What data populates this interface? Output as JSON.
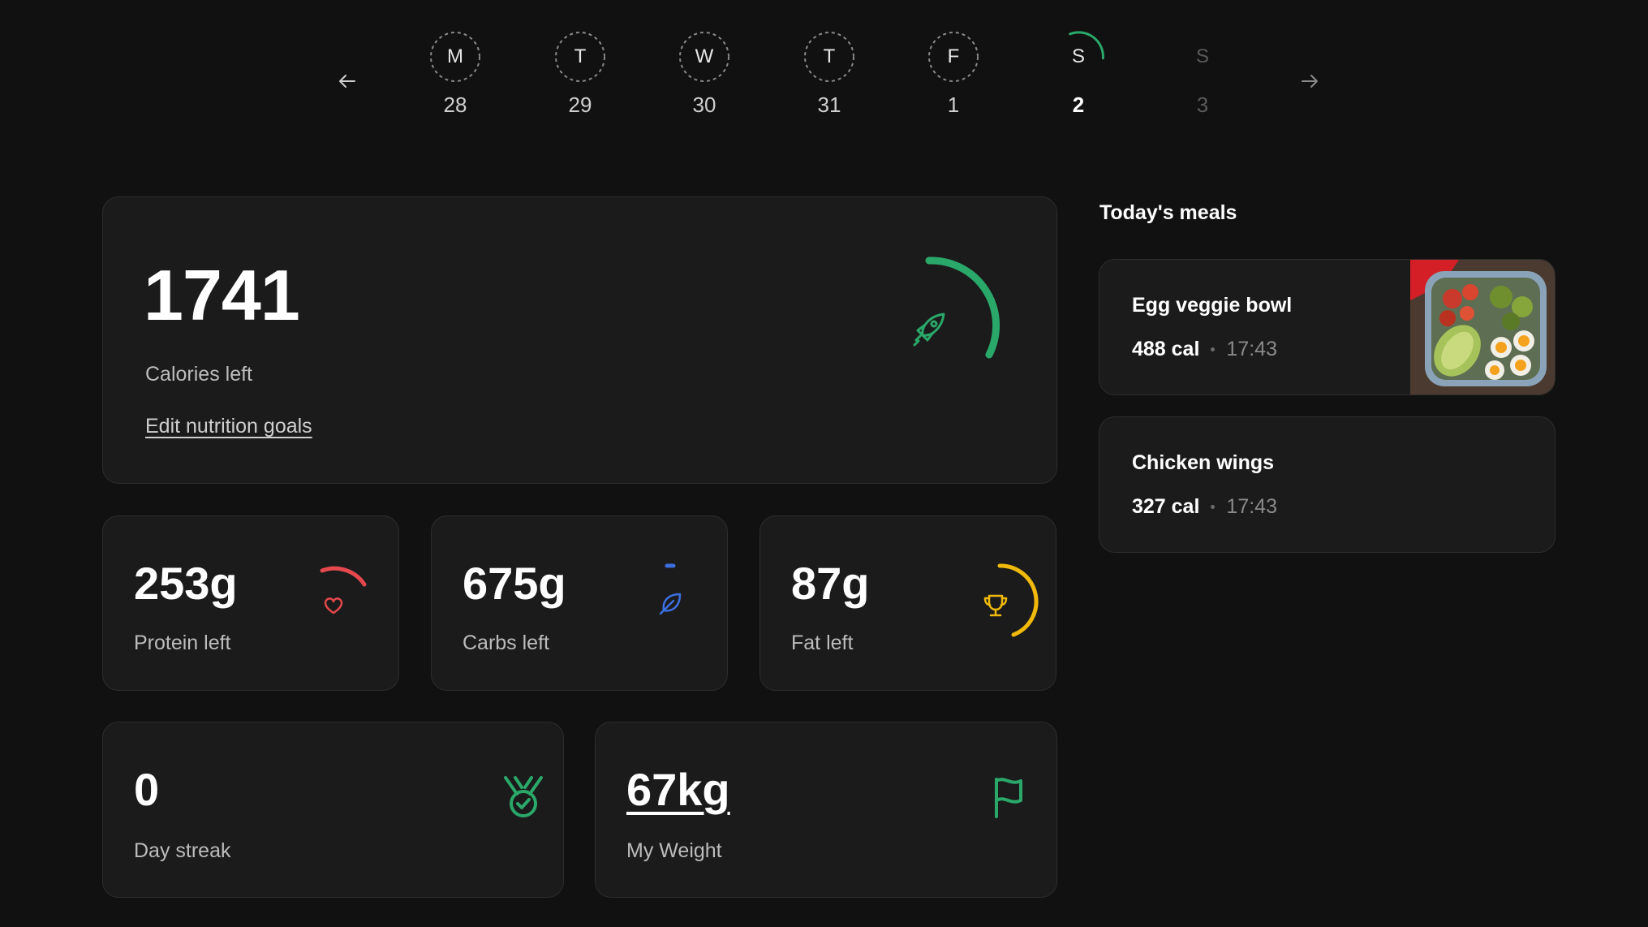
{
  "week": {
    "prev_icon": "arrow-left-icon",
    "next_icon": "arrow-right-icon",
    "days": [
      {
        "letter": "M",
        "date": "28"
      },
      {
        "letter": "T",
        "date": "29"
      },
      {
        "letter": "W",
        "date": "30"
      },
      {
        "letter": "T",
        "date": "31"
      },
      {
        "letter": "F",
        "date": "1"
      },
      {
        "letter": "S",
        "date": "2",
        "selected": true
      },
      {
        "letter": "S",
        "date": "3",
        "future": true
      }
    ]
  },
  "calories": {
    "value": "1741",
    "label": "Calories left",
    "edit_link": "Edit nutrition goals",
    "icon": "rocket-icon",
    "color": "#2aa86a"
  },
  "macros": {
    "protein": {
      "value": "253g",
      "label": "Protein left",
      "icon": "heart-icon",
      "color": "#e5484d"
    },
    "carbs": {
      "value": "675g",
      "label": "Carbs left",
      "icon": "leaf-icon",
      "color": "#3b6fe0"
    },
    "fat": {
      "value": "87g",
      "label": "Fat left",
      "icon": "trophy-icon",
      "color": "#f0b90b"
    }
  },
  "stats": {
    "streak": {
      "value": "0",
      "label": "Day streak",
      "icon": "medal-icon",
      "color": "#2aa86a"
    },
    "weight": {
      "value": "67kg",
      "label": "My Weight",
      "icon": "flag-icon",
      "color": "#2aa86a"
    }
  },
  "meals": {
    "title": "Today's meals",
    "items": [
      {
        "name": "Egg veggie bowl",
        "calories": "488 cal",
        "time": "17:43",
        "has_photo": true
      },
      {
        "name": "Chicken wings",
        "calories": "327 cal",
        "time": "17:43",
        "has_photo": false
      }
    ]
  }
}
